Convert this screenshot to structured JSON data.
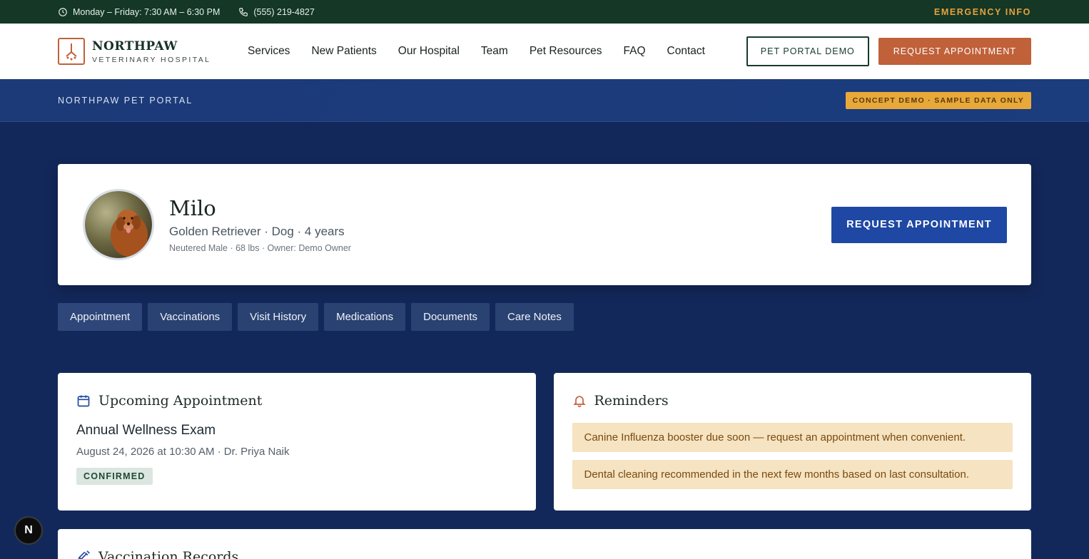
{
  "topbar": {
    "hours": "Monday – Friday: 7:30 AM – 6:30 PM",
    "phone": "(555) 219-4827",
    "emergency": "EMERGENCY INFO"
  },
  "brand": {
    "name": "NORTHPAW",
    "subtitle": "VETERINARY HOSPITAL"
  },
  "nav": [
    "Services",
    "New Patients",
    "Our Hospital",
    "Team",
    "Pet Resources",
    "FAQ",
    "Contact"
  ],
  "header_actions": {
    "portal_demo": "PET PORTAL DEMO",
    "request": "REQUEST APPOINTMENT"
  },
  "portal": {
    "label": "NORTHPAW PET PORTAL",
    "badge": "CONCEPT DEMO · SAMPLE DATA ONLY"
  },
  "pet": {
    "name": "Milo",
    "breed_line": "Golden Retriever · Dog · 4 years",
    "meta_line": "Neutered Male · 68 lbs · Owner: Demo Owner",
    "request_label": "REQUEST APPOINTMENT"
  },
  "tabs": [
    "Appointment",
    "Vaccinations",
    "Visit History",
    "Medications",
    "Documents",
    "Care Notes"
  ],
  "appointment": {
    "title": "Upcoming Appointment",
    "name": "Annual Wellness Exam",
    "when": "August 24, 2026 at 10:30 AM · Dr. Priya Naik",
    "status": "CONFIRMED"
  },
  "reminders": {
    "title": "Reminders",
    "items": [
      "Canine Influenza booster due soon — request an appointment when convenient.",
      "Dental cleaning recommended in the next few months based on last consultation."
    ]
  },
  "vaccinations": {
    "title": "Vaccination Records"
  },
  "dev_badge": "N",
  "colors": {
    "topbar": "#143726",
    "accent_orange": "#c0613a",
    "portal_blue": "#1e48a3",
    "page_bg": "#13285a",
    "badge_gold": "#e8a93a"
  }
}
